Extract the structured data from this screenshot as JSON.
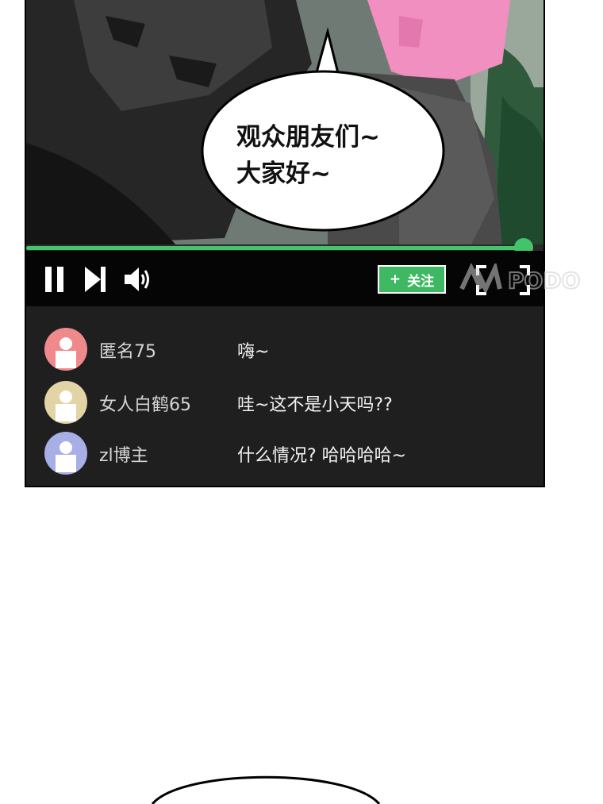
{
  "speech_bubble": {
    "line1": "观众朋友们~",
    "line2": "大家好~"
  },
  "player": {
    "progress_fraction": 0.98,
    "accent_color": "#43c46a",
    "follow_button": {
      "icon": "plus-icon",
      "plus": "+",
      "label": "关注"
    },
    "icons": {
      "pause": "pause-icon",
      "next": "skip-next-icon",
      "volume": "volume-icon",
      "fullscreen": "fullscreen-icon"
    },
    "watermark": "PODO"
  },
  "chat": [
    {
      "username": "匿名75",
      "message": "嗨~",
      "avatar_color": "#f0898c"
    },
    {
      "username": "女人白鹤65",
      "message": "哇~这不是小天吗??",
      "avatar_color": "#e3d4a6"
    },
    {
      "username": "zl博主",
      "message": "什么情况? 哈哈哈哈~",
      "avatar_color": "#a8aee6"
    }
  ]
}
